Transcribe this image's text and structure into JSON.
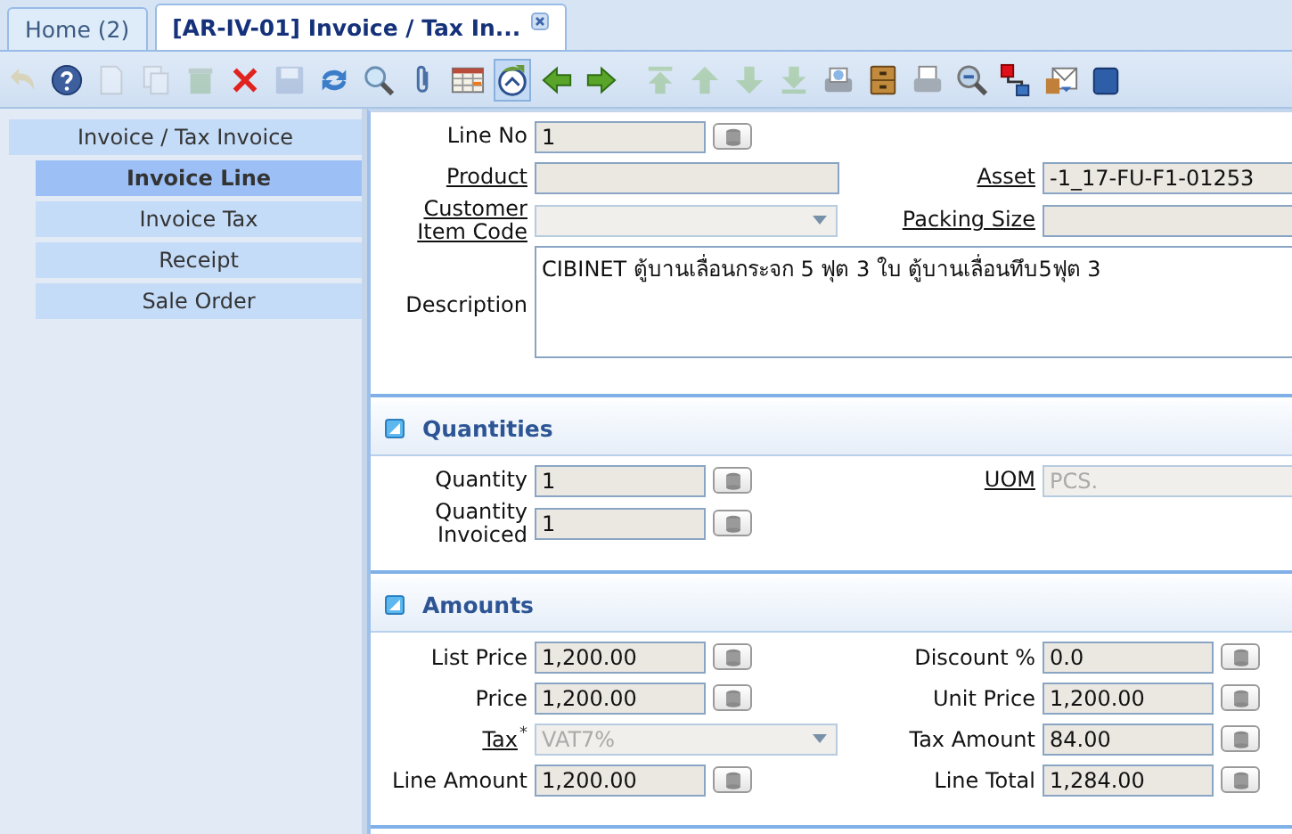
{
  "tabs": [
    {
      "label": "Home (2)",
      "selected": false,
      "closable": false
    },
    {
      "label": "[AR-IV-01] Invoice / Tax In...",
      "selected": true,
      "closable": true
    }
  ],
  "toolbar": {
    "groups": [
      [
        {
          "kind": "undo",
          "disabled": true,
          "selected": false
        },
        {
          "kind": "help",
          "disabled": false,
          "selected": false
        },
        {
          "kind": "new",
          "disabled": true,
          "selected": false
        },
        {
          "kind": "copy",
          "disabled": true,
          "selected": false
        },
        {
          "kind": "bin",
          "disabled": true,
          "selected": false
        },
        {
          "kind": "cross",
          "disabled": false,
          "selected": false
        },
        {
          "kind": "save",
          "disabled": true,
          "selected": false
        },
        {
          "kind": "refresh",
          "disabled": false,
          "selected": false
        },
        {
          "kind": "find",
          "disabled": false,
          "selected": false
        },
        {
          "kind": "clip",
          "disabled": false,
          "selected": false
        },
        {
          "kind": "grid",
          "disabled": false,
          "selected": false
        },
        {
          "kind": "history",
          "disabled": false,
          "selected": true
        },
        {
          "kind": "left",
          "disabled": false,
          "selected": false
        },
        {
          "kind": "right",
          "disabled": false,
          "selected": false
        }
      ],
      [
        {
          "kind": "first",
          "disabled": true,
          "selected": false
        },
        {
          "kind": "up",
          "disabled": true,
          "selected": false
        },
        {
          "kind": "down",
          "disabled": true,
          "selected": false
        },
        {
          "kind": "last",
          "disabled": true,
          "selected": false
        },
        {
          "kind": "report",
          "disabled": false,
          "selected": false
        },
        {
          "kind": "archive",
          "disabled": false,
          "selected": false
        },
        {
          "kind": "print",
          "disabled": false,
          "selected": false
        },
        {
          "kind": "zoom",
          "disabled": false,
          "selected": false
        },
        {
          "kind": "workflow",
          "disabled": false,
          "selected": false
        },
        {
          "kind": "mail",
          "disabled": false,
          "selected": false
        },
        {
          "kind": "cube",
          "disabled": false,
          "selected": false
        }
      ]
    ]
  },
  "sidebar": {
    "items": [
      {
        "label": "Invoice / Tax Invoice",
        "selected": false,
        "children": [
          {
            "label": "Invoice Line",
            "selected": true
          },
          {
            "label": "Invoice Tax",
            "selected": false
          },
          {
            "label": "Receipt",
            "selected": false
          },
          {
            "label": "Sale Order",
            "selected": false
          }
        ]
      }
    ]
  },
  "form": {
    "rows": [
      {
        "left": {
          "label": "Line No",
          "link": false,
          "kind": "number",
          "value": "1",
          "disabled": false
        }
      },
      {
        "left": {
          "label": "Product",
          "link": true,
          "kind": "text",
          "disabled": false
        },
        "right": {
          "label": "Asset",
          "link": true,
          "kind": "text",
          "value": "-1_17-FU-F1-01253",
          "disabled": false
        }
      },
      {
        "left": {
          "label": "Customer Item Code",
          "link": true,
          "kind": "combo",
          "disabled": true
        },
        "right": {
          "label": "Packing Size",
          "link": true,
          "kind": "text",
          "disabled": false
        }
      },
      {
        "wide": {
          "label": "Description",
          "link": false,
          "kind": "textarea",
          "value": "CIBINET ตู้บานเลื่อนกระจก 5 ฟุต 3 ใบ ตู้บานเลื่อนทึบ5ฟุต 3",
          "disabled": false
        }
      }
    ]
  },
  "sections": [
    {
      "title": "Quantities",
      "rows": [
        {
          "left": {
            "label": "Quantity",
            "link": false,
            "kind": "number",
            "value": "1",
            "disabled": false
          },
          "right": {
            "label": "UOM",
            "link": true,
            "kind": "text",
            "value": "PCS.",
            "disabled": true
          }
        },
        {
          "left": {
            "label": "Quantity Invoiced",
            "link": false,
            "kind": "number",
            "value": "1",
            "disabled": false
          }
        }
      ]
    },
    {
      "title": "Amounts",
      "rows": [
        {
          "left": {
            "label": "List Price",
            "link": false,
            "kind": "number",
            "value": "1,200.00",
            "disabled": false
          },
          "right": {
            "label": "Discount %",
            "link": false,
            "kind": "number",
            "value": "0.0",
            "disabled": false
          }
        },
        {
          "left": {
            "label": "Price",
            "link": false,
            "kind": "number",
            "value": "1,200.00",
            "disabled": false
          },
          "right": {
            "label": "Unit Price",
            "link": false,
            "kind": "number",
            "value": "1,200.00",
            "disabled": false
          }
        },
        {
          "left": {
            "label": "Tax",
            "link": true,
            "required_mark": "*",
            "kind": "combo",
            "value": "VAT7%",
            "disabled": true
          },
          "right": {
            "label": "Tax Amount",
            "link": false,
            "kind": "number",
            "value": "84.00",
            "disabled": false
          }
        },
        {
          "left": {
            "label": "Line Amount",
            "link": false,
            "kind": "number",
            "value": "1,200.00",
            "disabled": false
          },
          "right": {
            "label": "Line Total",
            "link": false,
            "kind": "number",
            "value": "1,284.00",
            "disabled": false
          }
        }
      ]
    }
  ]
}
